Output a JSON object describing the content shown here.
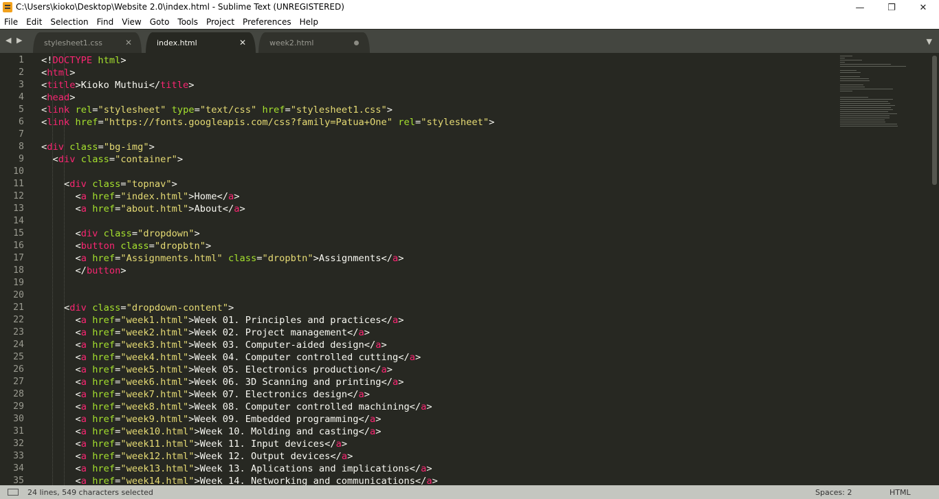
{
  "window": {
    "title": "C:\\Users\\kioko\\Desktop\\Website 2.0\\index.html - Sublime Text (UNREGISTERED)",
    "controls": {
      "minimize": "—",
      "maximize": "❐",
      "close": "✕"
    }
  },
  "menubar": {
    "items": [
      "File",
      "Edit",
      "Selection",
      "Find",
      "View",
      "Goto",
      "Tools",
      "Project",
      "Preferences",
      "Help"
    ]
  },
  "tabbar": {
    "nav_icon": "◀ ▶",
    "menu_icon": "▼",
    "tabs": [
      {
        "label": "stylesheet1.css",
        "active": false,
        "close": "✕"
      },
      {
        "label": "index.html",
        "active": true,
        "close": "✕"
      },
      {
        "label": "week2.html",
        "active": false,
        "unsaved": true
      }
    ]
  },
  "editor": {
    "line_numbers": [
      "1",
      "2",
      "3",
      "4",
      "5",
      "6",
      "7",
      "8",
      "9",
      "10",
      "11",
      "12",
      "13",
      "14",
      "15",
      "16",
      "17",
      "18",
      "19",
      "20",
      "21",
      "22",
      "23",
      "24",
      "25",
      "26",
      "27",
      "28",
      "29",
      "30",
      "31",
      "32",
      "33",
      "34",
      "35"
    ],
    "lines": [
      [
        [
          "p",
          "<!"
        ],
        [
          "t",
          "DOCTYPE"
        ],
        [
          "p",
          " "
        ],
        [
          "a",
          "html"
        ],
        [
          "p",
          ">"
        ]
      ],
      [
        [
          "p",
          "<"
        ],
        [
          "t",
          "html"
        ],
        [
          "p",
          ">"
        ]
      ],
      [
        [
          "p",
          "<"
        ],
        [
          "t",
          "title"
        ],
        [
          "p",
          ">Kioko Muthui</"
        ],
        [
          "t",
          "title"
        ],
        [
          "p",
          ">"
        ]
      ],
      [
        [
          "p",
          "<"
        ],
        [
          "t",
          "head"
        ],
        [
          "p",
          ">"
        ]
      ],
      [
        [
          "p",
          "<"
        ],
        [
          "t",
          "link"
        ],
        [
          "p",
          " "
        ],
        [
          "a",
          "rel"
        ],
        [
          "p",
          "="
        ],
        [
          "s",
          "\"stylesheet\""
        ],
        [
          "p",
          " "
        ],
        [
          "a",
          "type"
        ],
        [
          "p",
          "="
        ],
        [
          "s",
          "\"text/css\""
        ],
        [
          "p",
          " "
        ],
        [
          "a",
          "href"
        ],
        [
          "p",
          "="
        ],
        [
          "s",
          "\"stylesheet1.css\""
        ],
        [
          "p",
          ">"
        ]
      ],
      [
        [
          "p",
          "<"
        ],
        [
          "t",
          "link"
        ],
        [
          "p",
          " "
        ],
        [
          "a",
          "href"
        ],
        [
          "p",
          "="
        ],
        [
          "s",
          "\"https://fonts.googleapis.com/css?family=Patua+One\""
        ],
        [
          "p",
          " "
        ],
        [
          "a",
          "rel"
        ],
        [
          "p",
          "="
        ],
        [
          "s",
          "\"stylesheet\""
        ],
        [
          "p",
          ">"
        ]
      ],
      [],
      [
        [
          "p",
          "<"
        ],
        [
          "t",
          "div"
        ],
        [
          "p",
          " "
        ],
        [
          "a",
          "class"
        ],
        [
          "p",
          "="
        ],
        [
          "s",
          "\"bg-img\""
        ],
        [
          "p",
          ">"
        ]
      ],
      [
        [
          "p",
          "  <"
        ],
        [
          "t",
          "div"
        ],
        [
          "p",
          " "
        ],
        [
          "a",
          "class"
        ],
        [
          "p",
          "="
        ],
        [
          "s",
          "\"container\""
        ],
        [
          "p",
          ">"
        ]
      ],
      [],
      [
        [
          "p",
          "    <"
        ],
        [
          "t",
          "div"
        ],
        [
          "p",
          " "
        ],
        [
          "a",
          "class"
        ],
        [
          "p",
          "="
        ],
        [
          "s",
          "\"topnav\""
        ],
        [
          "p",
          ">"
        ]
      ],
      [
        [
          "p",
          "      <"
        ],
        [
          "t",
          "a"
        ],
        [
          "p",
          " "
        ],
        [
          "a",
          "href"
        ],
        [
          "p",
          "="
        ],
        [
          "s",
          "\"index.html\""
        ],
        [
          "p",
          ">Home</"
        ],
        [
          "t",
          "a"
        ],
        [
          "p",
          ">"
        ]
      ],
      [
        [
          "p",
          "      <"
        ],
        [
          "t",
          "a"
        ],
        [
          "p",
          " "
        ],
        [
          "a",
          "href"
        ],
        [
          "p",
          "="
        ],
        [
          "s",
          "\"about.html\""
        ],
        [
          "p",
          ">About</"
        ],
        [
          "t",
          "a"
        ],
        [
          "p",
          ">"
        ]
      ],
      [],
      [
        [
          "p",
          "      <"
        ],
        [
          "t",
          "div"
        ],
        [
          "p",
          " "
        ],
        [
          "a",
          "class"
        ],
        [
          "p",
          "="
        ],
        [
          "s",
          "\"dropdown\""
        ],
        [
          "p",
          ">"
        ]
      ],
      [
        [
          "p",
          "      <"
        ],
        [
          "t",
          "button"
        ],
        [
          "p",
          " "
        ],
        [
          "a",
          "class"
        ],
        [
          "p",
          "="
        ],
        [
          "s",
          "\"dropbtn\""
        ],
        [
          "p",
          ">"
        ]
      ],
      [
        [
          "p",
          "      <"
        ],
        [
          "t",
          "a"
        ],
        [
          "p",
          " "
        ],
        [
          "a",
          "href"
        ],
        [
          "p",
          "="
        ],
        [
          "s",
          "\"Assignments.html\""
        ],
        [
          "p",
          " "
        ],
        [
          "a",
          "class"
        ],
        [
          "p",
          "="
        ],
        [
          "s",
          "\"dropbtn\""
        ],
        [
          "p",
          ">Assignments</"
        ],
        [
          "t",
          "a"
        ],
        [
          "p",
          ">"
        ]
      ],
      [
        [
          "p",
          "      </"
        ],
        [
          "t",
          "button"
        ],
        [
          "p",
          ">"
        ]
      ],
      [],
      [],
      [
        [
          "p",
          "    <"
        ],
        [
          "t",
          "div"
        ],
        [
          "p",
          " "
        ],
        [
          "a",
          "class"
        ],
        [
          "p",
          "="
        ],
        [
          "s",
          "\"dropdown-content\""
        ],
        [
          "p",
          ">"
        ]
      ],
      [
        [
          "p",
          "      <"
        ],
        [
          "t",
          "a"
        ],
        [
          "p",
          " "
        ],
        [
          "a",
          "href"
        ],
        [
          "p",
          "="
        ],
        [
          "s",
          "\"week1.html\""
        ],
        [
          "p",
          ">Week 01. Principles and practices</"
        ],
        [
          "t",
          "a"
        ],
        [
          "p",
          ">"
        ]
      ],
      [
        [
          "p",
          "      <"
        ],
        [
          "t",
          "a"
        ],
        [
          "p",
          " "
        ],
        [
          "a",
          "href"
        ],
        [
          "p",
          "="
        ],
        [
          "s",
          "\"week2.html\""
        ],
        [
          "p",
          ">Week 02. Project management</"
        ],
        [
          "t",
          "a"
        ],
        [
          "p",
          ">"
        ]
      ],
      [
        [
          "p",
          "      <"
        ],
        [
          "t",
          "a"
        ],
        [
          "p",
          " "
        ],
        [
          "a",
          "href"
        ],
        [
          "p",
          "="
        ],
        [
          "s",
          "\"week3.html\""
        ],
        [
          "p",
          ">Week 03. Computer-aided design</"
        ],
        [
          "t",
          "a"
        ],
        [
          "p",
          ">"
        ]
      ],
      [
        [
          "p",
          "      <"
        ],
        [
          "t",
          "a"
        ],
        [
          "p",
          " "
        ],
        [
          "a",
          "href"
        ],
        [
          "p",
          "="
        ],
        [
          "s",
          "\"week4.html\""
        ],
        [
          "p",
          ">Week 04. Computer controlled cutting</"
        ],
        [
          "t",
          "a"
        ],
        [
          "p",
          ">"
        ]
      ],
      [
        [
          "p",
          "      <"
        ],
        [
          "t",
          "a"
        ],
        [
          "p",
          " "
        ],
        [
          "a",
          "href"
        ],
        [
          "p",
          "="
        ],
        [
          "s",
          "\"week5.html\""
        ],
        [
          "p",
          ">Week 05. Electronics production</"
        ],
        [
          "t",
          "a"
        ],
        [
          "p",
          ">"
        ]
      ],
      [
        [
          "p",
          "      <"
        ],
        [
          "t",
          "a"
        ],
        [
          "p",
          " "
        ],
        [
          "a",
          "href"
        ],
        [
          "p",
          "="
        ],
        [
          "s",
          "\"week6.html\""
        ],
        [
          "p",
          ">Week 06. 3D Scanning and printing</"
        ],
        [
          "t",
          "a"
        ],
        [
          "p",
          ">"
        ]
      ],
      [
        [
          "p",
          "      <"
        ],
        [
          "t",
          "a"
        ],
        [
          "p",
          " "
        ],
        [
          "a",
          "href"
        ],
        [
          "p",
          "="
        ],
        [
          "s",
          "\"week7.html\""
        ],
        [
          "p",
          ">Week 07. Electronics design</"
        ],
        [
          "t",
          "a"
        ],
        [
          "p",
          ">"
        ]
      ],
      [
        [
          "p",
          "      <"
        ],
        [
          "t",
          "a"
        ],
        [
          "p",
          " "
        ],
        [
          "a",
          "href"
        ],
        [
          "p",
          "="
        ],
        [
          "s",
          "\"week8.html\""
        ],
        [
          "p",
          ">Week 08. Computer controlled machining</"
        ],
        [
          "t",
          "a"
        ],
        [
          "p",
          ">"
        ]
      ],
      [
        [
          "p",
          "      <"
        ],
        [
          "t",
          "a"
        ],
        [
          "p",
          " "
        ],
        [
          "a",
          "href"
        ],
        [
          "p",
          "="
        ],
        [
          "s",
          "\"week9.html\""
        ],
        [
          "p",
          ">Week 09. Embedded programming</"
        ],
        [
          "t",
          "a"
        ],
        [
          "p",
          ">"
        ]
      ],
      [
        [
          "p",
          "      <"
        ],
        [
          "t",
          "a"
        ],
        [
          "p",
          " "
        ],
        [
          "a",
          "href"
        ],
        [
          "p",
          "="
        ],
        [
          "s",
          "\"week10.html\""
        ],
        [
          "p",
          ">Week 10. Molding and casting</"
        ],
        [
          "t",
          "a"
        ],
        [
          "p",
          ">"
        ]
      ],
      [
        [
          "p",
          "      <"
        ],
        [
          "t",
          "a"
        ],
        [
          "p",
          " "
        ],
        [
          "a",
          "href"
        ],
        [
          "p",
          "="
        ],
        [
          "s",
          "\"week11.html\""
        ],
        [
          "p",
          ">Week 11. Input devices</"
        ],
        [
          "t",
          "a"
        ],
        [
          "p",
          ">"
        ]
      ],
      [
        [
          "p",
          "      <"
        ],
        [
          "t",
          "a"
        ],
        [
          "p",
          " "
        ],
        [
          "a",
          "href"
        ],
        [
          "p",
          "="
        ],
        [
          "s",
          "\"week12.html\""
        ],
        [
          "p",
          ">Week 12. Output devices</"
        ],
        [
          "t",
          "a"
        ],
        [
          "p",
          ">"
        ]
      ],
      [
        [
          "p",
          "      <"
        ],
        [
          "t",
          "a"
        ],
        [
          "p",
          " "
        ],
        [
          "a",
          "href"
        ],
        [
          "p",
          "="
        ],
        [
          "s",
          "\"week13.html\""
        ],
        [
          "p",
          ">Week 13. Aplications and implications</"
        ],
        [
          "t",
          "a"
        ],
        [
          "p",
          ">"
        ]
      ],
      [
        [
          "p",
          "      <"
        ],
        [
          "t",
          "a"
        ],
        [
          "p",
          " "
        ],
        [
          "a",
          "href"
        ],
        [
          "p",
          "="
        ],
        [
          "s",
          "\"week14.html\""
        ],
        [
          "p",
          ">Week 14. Networking and communications</"
        ],
        [
          "t",
          "a"
        ],
        [
          "p",
          ">"
        ]
      ]
    ]
  },
  "statusbar": {
    "selection": "24 lines, 549 characters selected",
    "spaces": "Spaces: 2",
    "syntax": "HTML"
  },
  "theme": {
    "editor_bg": "#272822",
    "tag": "#f92672",
    "attribute": "#a6e22e",
    "string": "#e6db74",
    "text": "#f8f8f2"
  }
}
